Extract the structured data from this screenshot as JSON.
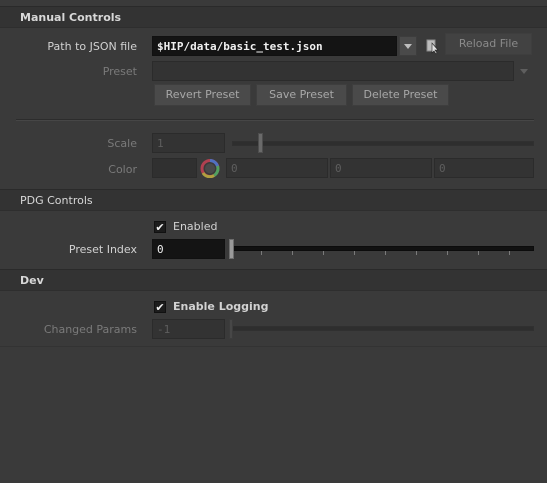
{
  "manual_controls": {
    "header": "Manual Controls",
    "json_path_label": "Path to JSON file",
    "json_path_value": "$HIP/data/basic_test.json",
    "reload_label": "Reload File",
    "preset_label": "Preset",
    "preset_value": "",
    "revert_label": "Revert Preset",
    "save_label": "Save Preset",
    "delete_label": "Delete Preset",
    "scale_label": "Scale",
    "scale_value": "1",
    "color_label": "Color",
    "color_values": [
      "0",
      "0",
      "0"
    ]
  },
  "pdg_controls": {
    "header": "PDG Controls",
    "enabled_label": "Enabled",
    "enabled": true,
    "preset_index_label": "Preset Index",
    "preset_index_value": "0"
  },
  "dev": {
    "header": "Dev",
    "enable_logging_label": "Enable Logging",
    "enable_logging": true,
    "changed_params_label": "Changed Params",
    "changed_params_value": "-1"
  },
  "icons": {
    "dropdown": "chevron-down-icon",
    "file_chooser": "file-chooser-icon",
    "color_wheel": "color-wheel-icon",
    "check": "checkmark-icon"
  },
  "colors": {
    "panel_bg": "#3a3a3a",
    "header_bg": "#333333",
    "active_field_bg": "#141414"
  }
}
